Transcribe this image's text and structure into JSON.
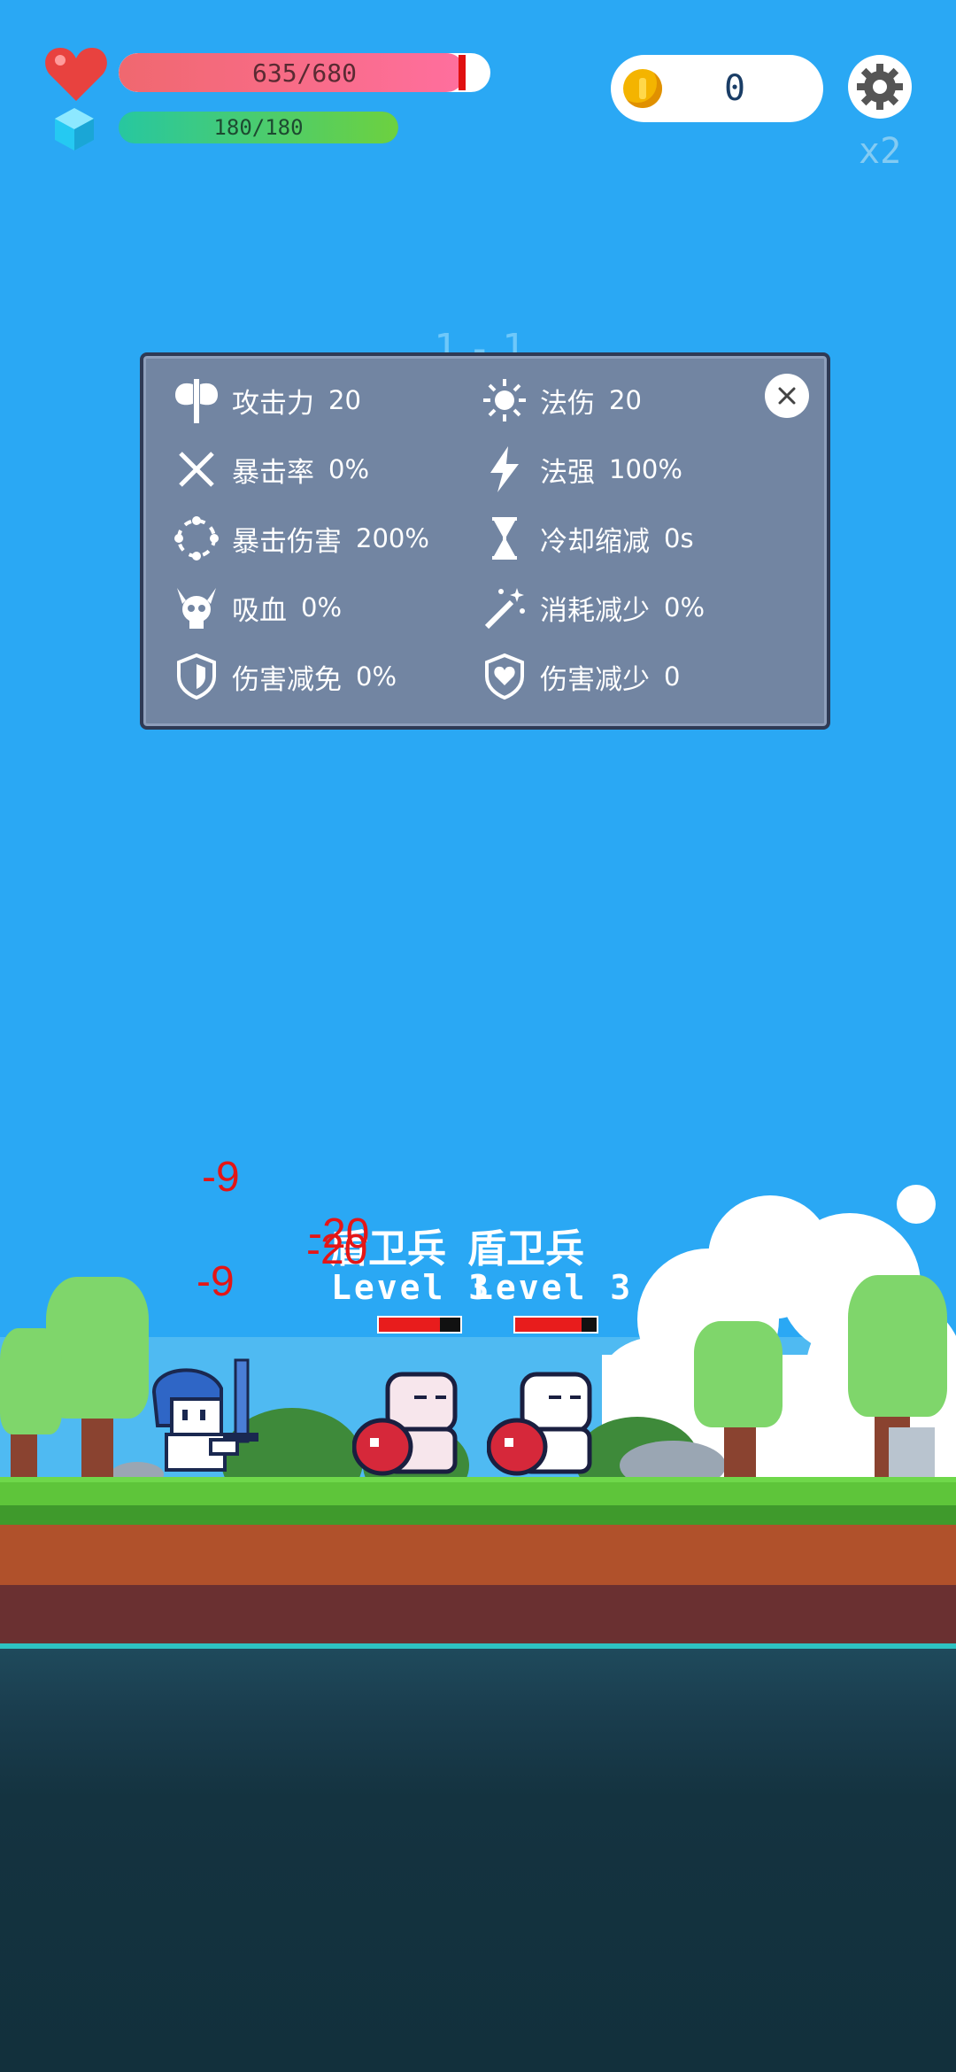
{
  "hud": {
    "hp_text": "635/680",
    "hp_fraction": 0.934,
    "mp_text": "180/180",
    "mp_fraction": 1.0,
    "coins": "0",
    "speed": "x2"
  },
  "wave": {
    "label": "1-1"
  },
  "stats_panel": {
    "left": [
      {
        "icon": "axe-icon",
        "label": "攻击力",
        "value": "20"
      },
      {
        "icon": "crossed-swords-icon",
        "label": "暴击率",
        "value": "0%"
      },
      {
        "icon": "circle-burst-icon",
        "label": "暴击伤害",
        "value": "200%"
      },
      {
        "icon": "horned-skull-icon",
        "label": "吸血",
        "value": "0%"
      },
      {
        "icon": "shield-icon",
        "label": "伤害减免",
        "value": "0%"
      }
    ],
    "right": [
      {
        "icon": "sun-icon",
        "label": "法伤",
        "value": "20"
      },
      {
        "icon": "lightning-icon",
        "label": "法强",
        "value": "100%"
      },
      {
        "icon": "hourglass-icon",
        "label": "冷却缩减",
        "value": "0s"
      },
      {
        "icon": "magic-wand-icon",
        "label": "消耗减少",
        "value": "0%"
      },
      {
        "icon": "heart-shield-icon",
        "label": "伤害减少",
        "value": "0"
      }
    ]
  },
  "enemies": [
    {
      "name": "盾卫兵",
      "level": "Level 3",
      "hp_fraction": 0.75
    },
    {
      "name": "盾卫兵",
      "level": "Level 3",
      "hp_fraction": 0.82
    }
  ],
  "damage_numbers": [
    "-9",
    "-9",
    "-20",
    "-20"
  ],
  "colors": {
    "sky": "#2aa8f4",
    "panel": "#7285a2",
    "hp": "#f0686f",
    "damage": "#e41616"
  }
}
